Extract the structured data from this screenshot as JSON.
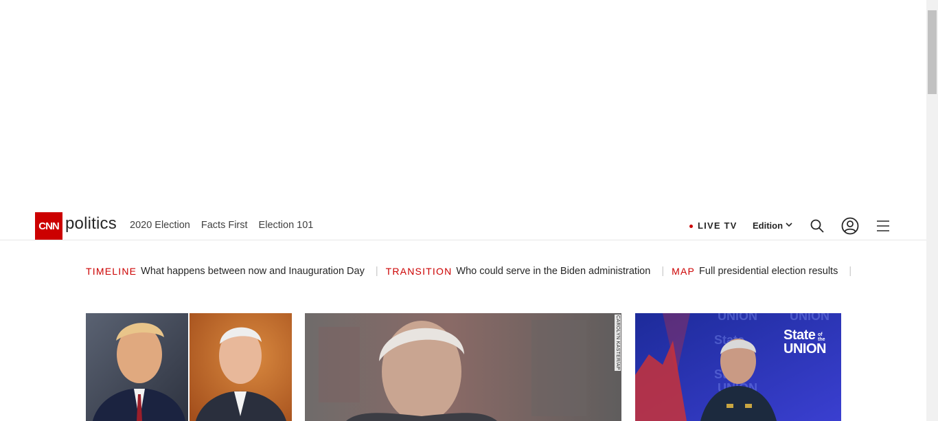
{
  "header": {
    "logo_text": "CNN",
    "section_name": "politics",
    "nav_items": [
      "2020 Election",
      "Facts First",
      "Election 101"
    ],
    "live_tv_label": "LIVE TV",
    "edition_label": "Edition"
  },
  "trending": [
    {
      "label": "TIMELINE",
      "text": "What happens between now and Inauguration Day"
    },
    {
      "label": "TRANSITION",
      "text": "Who could serve in the Biden administration"
    },
    {
      "label": "MAP",
      "text": "Full presidential election results"
    }
  ],
  "cards": {
    "middle_photo_credit": "CAROLYN KASTER/AP",
    "right_overlay_line1": "State",
    "right_overlay_line2": "UNION",
    "right_overlay_small": "of the"
  },
  "colors": {
    "brand_red": "#cc0000",
    "text": "#262626",
    "divider": "#e6e6e6"
  },
  "icons": [
    "search-icon",
    "user-account-icon",
    "hamburger-menu-icon",
    "chevron-down-icon",
    "live-dot-icon"
  ]
}
